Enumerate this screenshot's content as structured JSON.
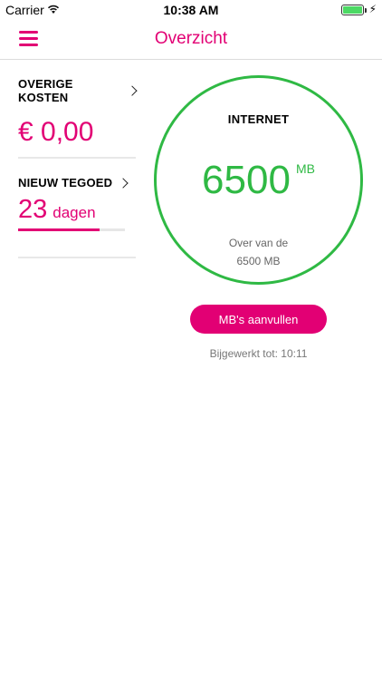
{
  "status_bar": {
    "carrier": "Carrier",
    "time": "10:38 AM"
  },
  "nav": {
    "title": "Overzicht"
  },
  "other_costs": {
    "title": "OVERIGE KOSTEN",
    "amount": "€ 0,00"
  },
  "new_credit": {
    "title": "NIEUW TEGOED",
    "days": "23",
    "unit": "dagen",
    "progress": 0.76
  },
  "internet": {
    "title": "INTERNET",
    "value": "6500",
    "unit": "MB",
    "sub_line1": "Over van de",
    "sub_line2": "6500 MB"
  },
  "topup_button": {
    "label": "MB's aanvullen"
  },
  "updated": "Bijgewerkt tot: 10:11",
  "colors": {
    "brand": "#e20074",
    "ok": "#2fb944"
  }
}
